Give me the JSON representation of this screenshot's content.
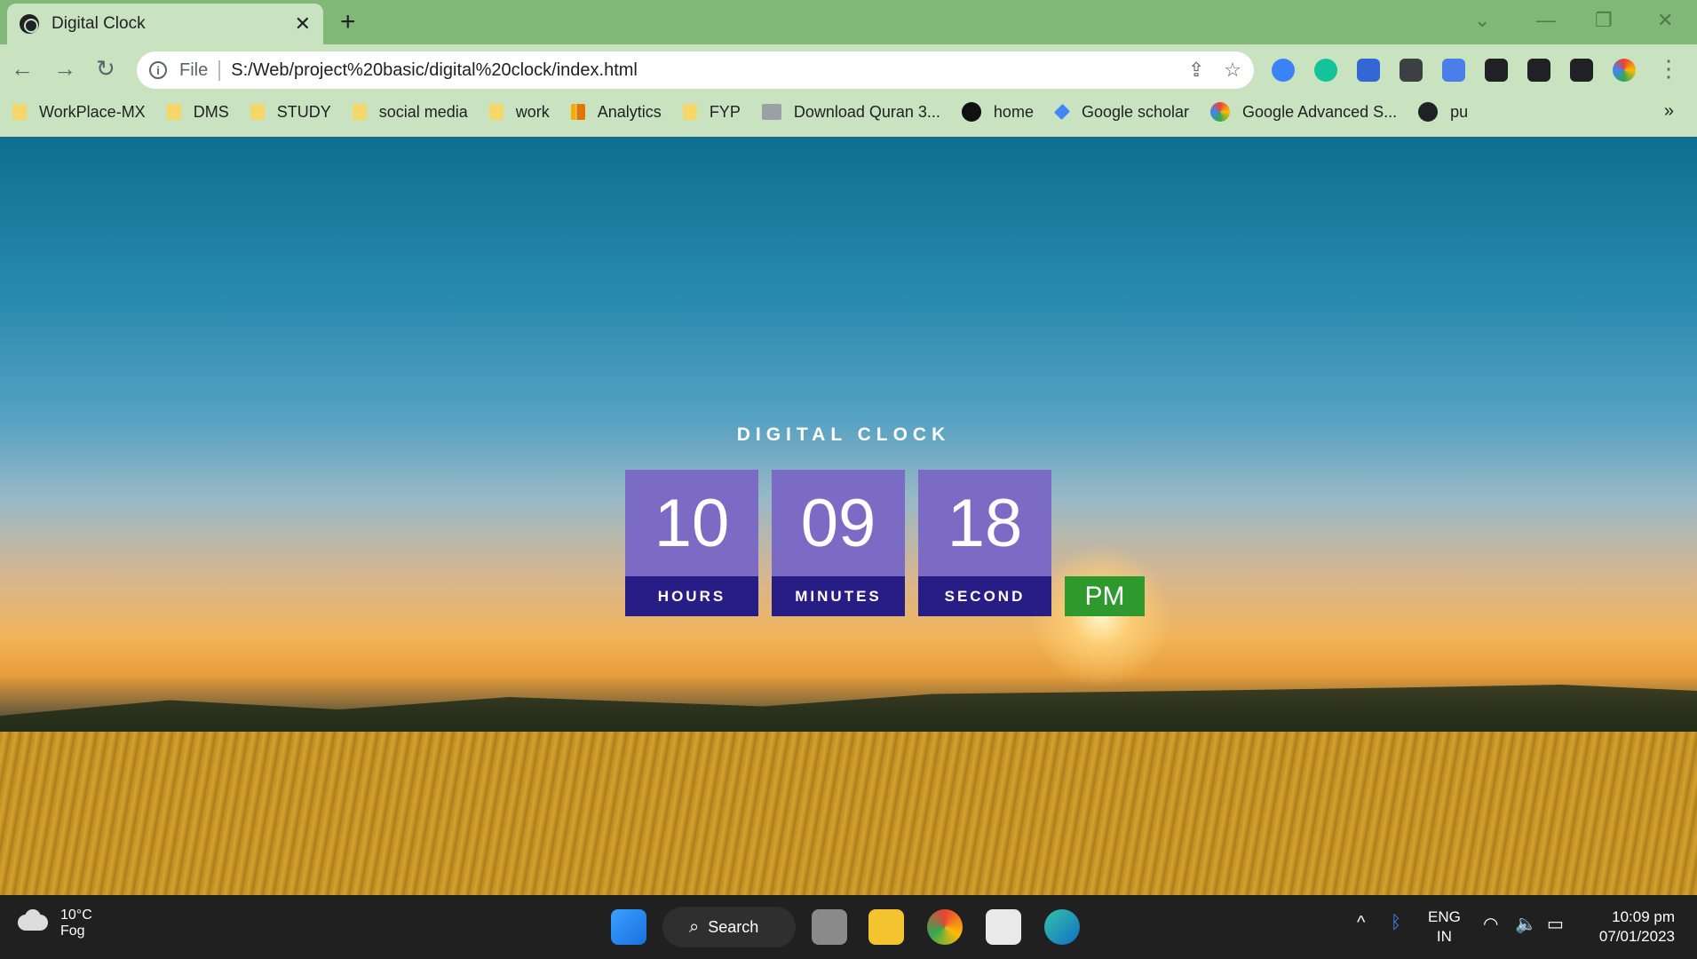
{
  "browser": {
    "tab_title": "Digital Clock",
    "tab_close": "✕",
    "new_tab": "+",
    "address": {
      "scheme_label": "File",
      "url": "S:/Web/project%20basic/digital%20clock/index.html"
    },
    "bookmarks": [
      {
        "label": "WorkPlace-MX",
        "icon": "folder-icon"
      },
      {
        "label": "DMS",
        "icon": "folder-icon"
      },
      {
        "label": "STUDY",
        "icon": "folder-icon"
      },
      {
        "label": "social media",
        "icon": "folder-icon"
      },
      {
        "label": "work",
        "icon": "folder-icon"
      },
      {
        "label": "Analytics",
        "icon": "analytics-icon"
      },
      {
        "label": "FYP",
        "icon": "folder-icon"
      },
      {
        "label": "Download Quran 3...",
        "icon": "quran-icon"
      },
      {
        "label": "home",
        "icon": "home-site-icon"
      },
      {
        "label": "Google scholar",
        "icon": "scholar-icon"
      },
      {
        "label": "Google Advanced S...",
        "icon": "google-icon"
      },
      {
        "label": "pu",
        "icon": "globe-icon"
      }
    ],
    "bookmarks_more": "»"
  },
  "clock": {
    "title": "DIGITAL CLOCK",
    "hours": "10",
    "minutes": "09",
    "seconds": "18",
    "hours_label": "HOURS",
    "minutes_label": "MINUTES",
    "seconds_label": "SECOND",
    "ampm": "PM",
    "colors": {
      "digit_bg": "#7c6bc4",
      "label_bg": "#281c85",
      "ampm_bg": "#2e9a2e"
    }
  },
  "taskbar": {
    "weather_temp": "10°C",
    "weather_desc": "Fog",
    "search_label": "Search",
    "lang_line1": "ENG",
    "lang_line2": "IN",
    "time": "10:09 pm",
    "date": "07/01/2023"
  }
}
